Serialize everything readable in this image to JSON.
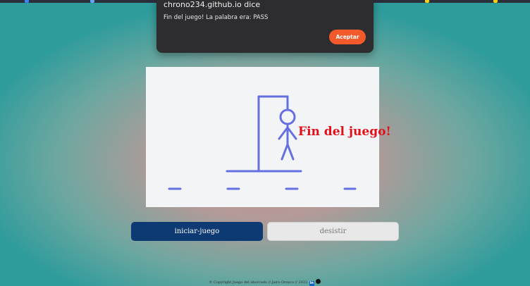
{
  "alert": {
    "title": "chrono234.github.io dice",
    "message": "Fin del juego! La palabra era: PASS",
    "accept_label": "Aceptar"
  },
  "game": {
    "status_message": "Fin del juego!",
    "word_slots": 4,
    "colors": {
      "gallows": "#6470e0",
      "message": "#e3101a",
      "board": "#f3f4f6"
    }
  },
  "buttons": {
    "start_label": "iniciar-juego",
    "quit_label": "desistir"
  },
  "footer": {
    "text": "© Copyright Juego del ahorcado // Jairo Orozco // 2022",
    "linkedin_label": "in"
  }
}
